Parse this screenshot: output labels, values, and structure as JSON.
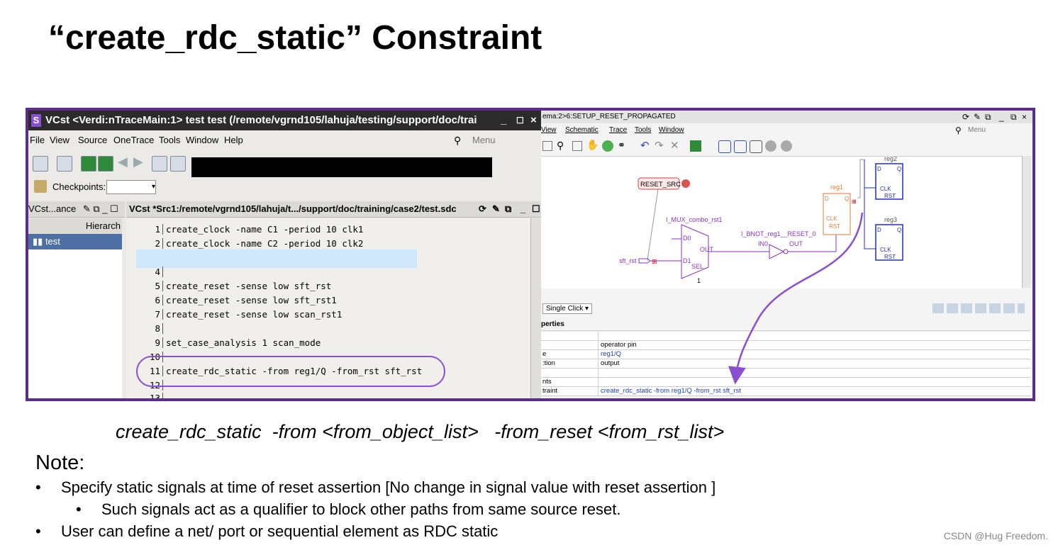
{
  "slide": {
    "title": "“create_rdc_static” Constraint",
    "syntax": "create_rdc_static  -from <from_object_list>   -from_reset <from_rst_list>",
    "note_label": "Note",
    "note_colon": ":",
    "bullets": [
      {
        "text": "Specify static signals at time of reset assertion [No change in signal value with reset assertion ]",
        "level": 1
      },
      {
        "text": "Such signals act as a qualifier to block other paths from same source reset.",
        "level": 2
      },
      {
        "text": "User can define a net/ port or sequential element as RDC static",
        "level": 1
      }
    ],
    "bullet_glyph": "•",
    "watermark": "CSDN @Hug Freedom."
  },
  "left_window": {
    "title": "VCst <Verdi:nTraceMain:1> test test (/remote/vgrnd105/lahuja/testing/support/doc/trai",
    "menu": [
      "File",
      "View",
      "Source",
      "OneTrace",
      "Tools",
      "Window",
      "Help"
    ],
    "menu_search_placeholder": "Menu",
    "checkpoints_label": "Checkpoints:",
    "side_pane_title": "VCst...ance",
    "hierarchy_header": "Hierarch",
    "tree_item": "test",
    "source_pane_title": "VCst *Src1:/remote/vgrnd105/lahuja/t.../support/doc/training/case2/test.sdc",
    "code_lines": [
      {
        "num": "1",
        "text": "create_clock -name C1 -period 10 clk1"
      },
      {
        "num": "2",
        "text": "create_clock -name C2 -period 10 clk2"
      },
      {
        "num": "4",
        "text": ""
      },
      {
        "num": "5",
        "text": "create_reset -sense low sft_rst"
      },
      {
        "num": "6",
        "text": "create_reset -sense low sft_rst1"
      },
      {
        "num": "7",
        "text": "create_reset -sense low scan_rst1"
      },
      {
        "num": "8",
        "text": ""
      },
      {
        "num": "9",
        "text": "set_case_analysis 1 scan_mode"
      },
      {
        "num": "10",
        "text": ""
      },
      {
        "num": "11",
        "text": "create_rdc_static -from reg1/Q -from_rst sft_rst"
      },
      {
        "num": "12",
        "text": ""
      },
      {
        "num": "13",
        "text": ""
      }
    ]
  },
  "right_window": {
    "title": "ema:2>6:SETUP_RESET_PROPAGATED",
    "menu": [
      "View",
      "Schematic",
      "Trace",
      "Tools",
      "Window"
    ],
    "menu_search_placeholder": "Menu",
    "schematic": {
      "reset_src": "RESET_SRC",
      "mux": "I_MUX_combo_rst1",
      "mux_d0": "D0",
      "mux_d1": "D1",
      "mux_out": "OUT",
      "mux_sel": "SEL",
      "mux_sel_val": "1",
      "inverter": "I_BNOT_reg1__RESET_0",
      "inv_in": "IN0",
      "inv_out": "OUT",
      "net_in": "sft_rst",
      "reg1": "reg1",
      "reg2": "reg2",
      "reg3": "reg3",
      "pin_d": "D",
      "pin_q": "Q",
      "pin_clk": "CLK",
      "pin_rst": "RST"
    },
    "click_mode": "Single Click",
    "properties_title": "perties",
    "properties": [
      {
        "key": "",
        "value": ""
      },
      {
        "key": "",
        "value": "operator pin"
      },
      {
        "key": "e",
        "value": "reg1/Q"
      },
      {
        "key": ":tion",
        "value": "output"
      },
      {
        "key": "",
        "value": ""
      },
      {
        "key": "nts",
        "value": ""
      },
      {
        "key": "traint",
        "value": "create_rdc_static -from reg1/Q -from_rst sft_rst"
      }
    ]
  },
  "colors": {
    "frame_purple": "#5a2e86",
    "highlight_purple": "#8a4fd0",
    "schematic_purple": "#8b2fc9",
    "schematic_blue": "#1f2fbf",
    "highlight_line": "#cfe8fb",
    "link_blue": "#1b3fbf"
  }
}
